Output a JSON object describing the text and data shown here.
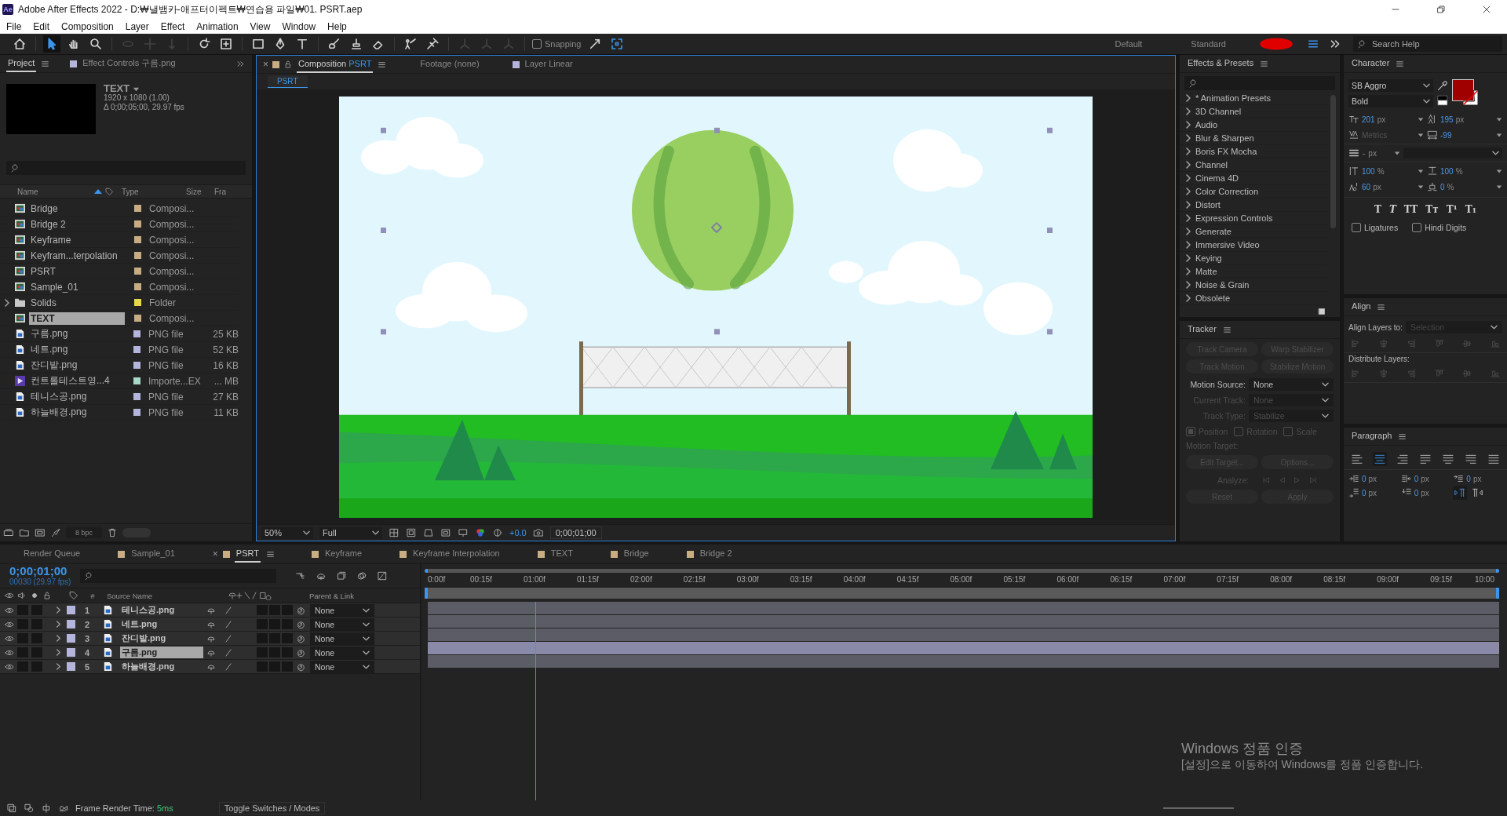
{
  "window": {
    "logo": "Ae",
    "title": "Adobe After Effects 2022 - D:₩낼뱀카-애프터이펙트₩연습용 파일₩01. PSRT.aep"
  },
  "menu": [
    "File",
    "Edit",
    "Composition",
    "Layer",
    "Effect",
    "Animation",
    "View",
    "Window",
    "Help"
  ],
  "tools": [
    {
      "kind": "home",
      "selected": false,
      "disabled": false
    },
    {
      "kind": "pointer",
      "selected": true,
      "disabled": false
    },
    {
      "kind": "hand",
      "selected": false,
      "disabled": false
    },
    {
      "kind": "zoom",
      "selected": false,
      "disabled": false
    },
    {
      "kind": "orbit",
      "selected": false,
      "disabled": true
    },
    {
      "kind": "move",
      "selected": false,
      "disabled": true
    },
    {
      "kind": "dolly",
      "selected": false,
      "disabled": true
    },
    {
      "kind": "rotate",
      "selected": false,
      "disabled": false
    },
    {
      "kind": "anchor",
      "selected": false,
      "disabled": false
    },
    {
      "kind": "rectangle",
      "selected": false,
      "disabled": false
    },
    {
      "kind": "pen",
      "selected": false,
      "disabled": false
    },
    {
      "kind": "type",
      "selected": false,
      "disabled": false
    },
    {
      "kind": "brush",
      "selected": false,
      "disabled": false
    },
    {
      "kind": "stamp",
      "selected": false,
      "disabled": false
    },
    {
      "kind": "eraser",
      "selected": false,
      "disabled": false
    },
    {
      "kind": "puppet",
      "selected": false,
      "disabled": false
    },
    {
      "kind": "pin",
      "selected": false,
      "disabled": false
    },
    {
      "kind": "axis",
      "selected": false,
      "disabled": true
    },
    {
      "kind": "axis",
      "selected": false,
      "disabled": true
    },
    {
      "kind": "axis",
      "selected": false,
      "disabled": true
    }
  ],
  "snapping": {
    "label": "Snapping",
    "checked": false
  },
  "workspaces": [
    "Default",
    "Standard"
  ],
  "search_help": {
    "placeholder": "Search Help"
  },
  "project": {
    "tabs": [
      {
        "label": "Project",
        "selected": true
      },
      {
        "label": "Effect Controls 구름.png",
        "selected": false,
        "color": "#b4b4dc"
      }
    ],
    "preview": {
      "name": "TEXT",
      "resolution": "1920 x 1080 (1.00)",
      "duration": "Δ 0;00;05;00, 29.97 fps"
    },
    "columns": [
      "Name",
      "Type",
      "Size",
      "Fra"
    ],
    "items": [
      {
        "name": "Bridge",
        "kind": "comp",
        "color": "#c8ac82",
        "type": "Composi...",
        "selected": false
      },
      {
        "name": "Bridge 2",
        "kind": "comp",
        "color": "#c8ac82",
        "type": "Composi...",
        "selected": false
      },
      {
        "name": "Keyframe",
        "kind": "comp",
        "color": "#c8ac82",
        "type": "Composi...",
        "selected": false
      },
      {
        "name": "Keyfram...terpolation",
        "kind": "comp",
        "color": "#c8ac82",
        "type": "Composi...",
        "selected": false
      },
      {
        "name": "PSRT",
        "kind": "comp",
        "color": "#c8ac82",
        "type": "Composi...",
        "selected": false
      },
      {
        "name": "Sample_01",
        "kind": "comp",
        "color": "#c8ac82",
        "type": "Composi...",
        "selected": false
      },
      {
        "name": "Solids",
        "kind": "folder",
        "color": "#e6d84a",
        "type": "Folder",
        "selected": false
      },
      {
        "name": "TEXT",
        "kind": "comp",
        "color": "#c8ac82",
        "type": "Composi...",
        "selected": true
      },
      {
        "name": "구름.png",
        "kind": "png",
        "color": "#b4b4dc",
        "type": "PNG file",
        "size": "25 KB",
        "selected": false
      },
      {
        "name": "네트.png",
        "kind": "png",
        "color": "#b4b4dc",
        "type": "PNG file",
        "size": "52 KB",
        "selected": false
      },
      {
        "name": "잔디밭.png",
        "kind": "png",
        "color": "#b4b4dc",
        "type": "PNG file",
        "size": "16 KB",
        "selected": false
      },
      {
        "name": "컨트롤테스트영...4",
        "kind": "video",
        "color": "#a8d8c8",
        "type": "Importe...EX",
        "size": "... MB",
        "selected": false
      },
      {
        "name": "테니스공.png",
        "kind": "png",
        "color": "#b4b4dc",
        "type": "PNG file",
        "size": "27 KB",
        "selected": false
      },
      {
        "name": "하늘배경.png",
        "kind": "png",
        "color": "#b4b4dc",
        "type": "PNG file",
        "size": "11 KB",
        "selected": false
      }
    ],
    "bit_depth": "8 bpc"
  },
  "composition": {
    "close": "×",
    "tabs": [
      {
        "label": "Composition",
        "name": "PSRT",
        "selected": true,
        "color": "#c8ac82"
      },
      {
        "label": "Footage (none)",
        "selected": false
      },
      {
        "label": "Layer",
        "name": "Linear",
        "selected": false,
        "color": "#b4b4dc"
      }
    ],
    "breadcrumb": "PSRT",
    "zoom": "50%",
    "resolution": "Full",
    "exposure": "+0.0",
    "timecode": "0;00;01;00"
  },
  "effects": {
    "title": "Effects & Presets",
    "items": [
      "* Animation Presets",
      "3D Channel",
      "Audio",
      "Blur & Sharpen",
      "Boris FX Mocha",
      "Channel",
      "Cinema 4D",
      "Color Correction",
      "Distort",
      "Expression Controls",
      "Generate",
      "Immersive Video",
      "Keying",
      "Matte",
      "Noise & Grain",
      "Obsolete"
    ]
  },
  "tracker": {
    "title": "Tracker",
    "buttons": [
      {
        "label": "Track Camera",
        "disabled": true
      },
      {
        "label": "Warp Stabilizer",
        "disabled": true
      },
      {
        "label": "Track Motion",
        "disabled": true
      },
      {
        "label": "Stabilize Motion",
        "disabled": true
      }
    ],
    "fields": [
      {
        "label": "Motion Source:",
        "value": "None",
        "disabled": false
      },
      {
        "label": "Current Track:",
        "value": "None",
        "disabled": true
      },
      {
        "label": "Track Type:",
        "value": "Stabilize",
        "disabled": true
      }
    ],
    "checks": [
      {
        "label": "Position",
        "checked": true,
        "disabled": true
      },
      {
        "label": "Rotation",
        "checked": false,
        "disabled": true
      },
      {
        "label": "Scale",
        "checked": false,
        "disabled": true
      }
    ],
    "motion_target": "Motion Target:",
    "target_buttons": [
      {
        "label": "Edit Target...",
        "disabled": true
      },
      {
        "label": "Options...",
        "disabled": true
      }
    ],
    "analyze": "Analyze:",
    "bottom_buttons": [
      {
        "label": "Reset",
        "disabled": true
      },
      {
        "label": "Apply",
        "disabled": true
      }
    ]
  },
  "character": {
    "title": "Character",
    "font": "SB Aggro",
    "style": "Bold",
    "fill": {
      "color": "#a00000"
    },
    "metrics": [
      {
        "kind": "size",
        "value": "201",
        "unit": "px",
        "disabled": false
      },
      {
        "kind": "leading",
        "value": "195",
        "unit": "px",
        "disabled": false
      },
      {
        "kind": "kerning",
        "value": "Metrics",
        "disabled": true
      },
      {
        "kind": "tracking",
        "value": "-99",
        "disabled": false
      }
    ],
    "stroke": {
      "value": "-",
      "unit": "px"
    },
    "scales": [
      {
        "kind": "vscale",
        "value": "100",
        "unit": "%",
        "disabled": false
      },
      {
        "kind": "hscale",
        "value": "100",
        "unit": "%",
        "disabled": false
      },
      {
        "kind": "baseline",
        "value": "60",
        "unit": "px",
        "disabled": false
      },
      {
        "kind": "tsume",
        "value": "0",
        "unit": "%",
        "disabled": false
      }
    ],
    "styles": [
      "T",
      "T",
      "TT",
      "Tт",
      "T¹",
      "T₁"
    ],
    "checks": [
      {
        "label": "Ligatures",
        "checked": false
      },
      {
        "label": "Hindi Digits",
        "checked": false
      }
    ]
  },
  "align": {
    "title": "Align",
    "layers_to_label": "Align Layers to:",
    "layers_to": "Selection",
    "distribute_label": "Distribute Layers:"
  },
  "paragraph": {
    "title": "Paragraph",
    "alignments": [
      {
        "selected": false
      },
      {
        "selected": true
      },
      {
        "selected": false
      },
      {
        "selected": false
      },
      {
        "selected": false
      },
      {
        "selected": false
      },
      {
        "selected": false
      }
    ],
    "indents": [
      {
        "value": "0",
        "unit": "px"
      },
      {
        "value": "0",
        "unit": "px"
      },
      {
        "value": "0",
        "unit": "px"
      },
      {
        "value": "0",
        "unit": "px"
      },
      {
        "value": "0",
        "unit": "px"
      }
    ],
    "directions": [
      {
        "selected": true
      },
      {
        "selected": false
      }
    ]
  },
  "timeline": {
    "close": "×",
    "tabs": [
      {
        "label": "Render Queue",
        "selected": false
      },
      {
        "label": "Sample_01",
        "selected": false,
        "color": "#c8ac82"
      },
      {
        "label": "PSRT",
        "selected": true,
        "color": "#c8ac82"
      },
      {
        "label": "Keyframe",
        "selected": false,
        "color": "#c8ac82"
      },
      {
        "label": "Keyframe Interpolation",
        "selected": false,
        "color": "#c8ac82"
      },
      {
        "label": "TEXT",
        "selected": false,
        "color": "#c8ac82"
      },
      {
        "label": "Bridge",
        "selected": false,
        "color": "#c8ac82"
      },
      {
        "label": "Bridge 2",
        "selected": false,
        "color": "#c8ac82"
      }
    ],
    "time": "0;00;01;00",
    "frames": "00030 (29.97 fps)",
    "number_heading": "#",
    "name_heading": "Source Name",
    "parent_heading": "Parent & Link",
    "layers": [
      {
        "number": "1",
        "name": "테니스공.png",
        "selected": false,
        "parent": "None",
        "color": "#b4b4dc"
      },
      {
        "number": "2",
        "name": "네트.png",
        "selected": false,
        "parent": "None",
        "color": "#b4b4dc"
      },
      {
        "number": "3",
        "name": "잔디밭.png",
        "selected": false,
        "parent": "None",
        "color": "#b4b4dc"
      },
      {
        "number": "4",
        "name": "구름.png",
        "selected": true,
        "parent": "None",
        "color": "#b4b4dc"
      },
      {
        "number": "5",
        "name": "하늘배경.png",
        "selected": false,
        "parent": "None",
        "color": "#b4b4dc"
      }
    ],
    "ruler": [
      "0:00f",
      "00:15f",
      "01:00f",
      "01:15f",
      "02:00f",
      "02:15f",
      "03:00f",
      "03:15f",
      "04:00f",
      "04:15f",
      "05:00f",
      "05:15f",
      "06:00f",
      "06:15f",
      "07:00f",
      "07:15f",
      "08:00f",
      "08:15f",
      "09:00f",
      "09:15f",
      "10:00"
    ],
    "playhead": {
      "level": 0.1
    }
  },
  "status": {
    "render_label": "Frame Render Time:",
    "render_time": "5ms",
    "toggle": "Toggle Switches / Modes"
  },
  "activation": {
    "title": "Windows 정품 인증",
    "text": "[설정]으로 이동하여 Windows를 정품 인증합니다."
  }
}
